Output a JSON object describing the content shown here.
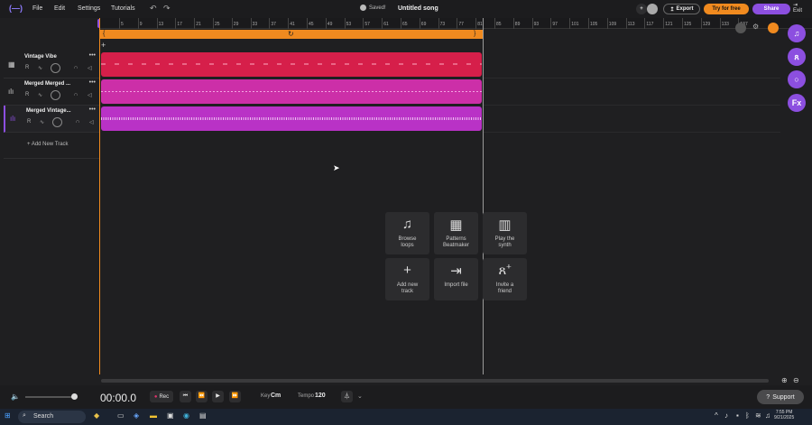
{
  "menu": {
    "logo": "(—)",
    "file": "File",
    "edit": "Edit",
    "settings": "Settings",
    "tutorials": "Tutorials"
  },
  "header": {
    "saved": "Saved!",
    "song_title": "Untitled song",
    "export": "Export",
    "try_free": "Try for free",
    "share": "Share",
    "exit": "Exit"
  },
  "ruler": {
    "ticks": [
      "5",
      "9",
      "13",
      "17",
      "21",
      "25",
      "29",
      "33",
      "37",
      "41",
      "45",
      "49",
      "53",
      "57",
      "61",
      "65",
      "69",
      "73",
      "77",
      "81",
      "85",
      "89",
      "93",
      "97",
      "101",
      "105",
      "109",
      "113",
      "117",
      "121",
      "125",
      "129",
      "133",
      "137"
    ]
  },
  "tracks": [
    {
      "name": "Vintage Vibe",
      "icon": "piano-icon",
      "clip_color": "#d61f4a"
    },
    {
      "name": "Merged Merged ...",
      "icon": "waveform-icon",
      "clip_color": "#cc2fa8"
    },
    {
      "name": "Merged Vintage...",
      "icon": "waveform-icon",
      "clip_color": "#b932c6"
    }
  ],
  "add_track": "Add New Track",
  "tiles": [
    {
      "icon": "music-note-icon",
      "label1": "Browse",
      "label2": "loops"
    },
    {
      "icon": "patterns-icon",
      "label1": "Patterns",
      "label2": "Beatmaker"
    },
    {
      "icon": "piano-keys-icon",
      "label1": "Play the",
      "label2": "synth"
    },
    {
      "icon": "plus-icon",
      "label1": "Add new",
      "label2": "track"
    },
    {
      "icon": "import-icon",
      "label1": "Import file",
      "label2": ""
    },
    {
      "icon": "invite-icon",
      "label1": "Invite a",
      "label2": "friend"
    }
  ],
  "transport": {
    "time": "00:00.0",
    "rec": "Rec",
    "key_label": "Key",
    "key_value": "Cm",
    "tempo_label": "Tempo",
    "tempo_value": "120",
    "support": "Support"
  },
  "taskbar": {
    "search": "Search",
    "time": "7:55 PM",
    "date": "9/21/2025"
  },
  "colors": {
    "accent_orange": "#f08a1f",
    "accent_purple": "#8c4fe0"
  }
}
